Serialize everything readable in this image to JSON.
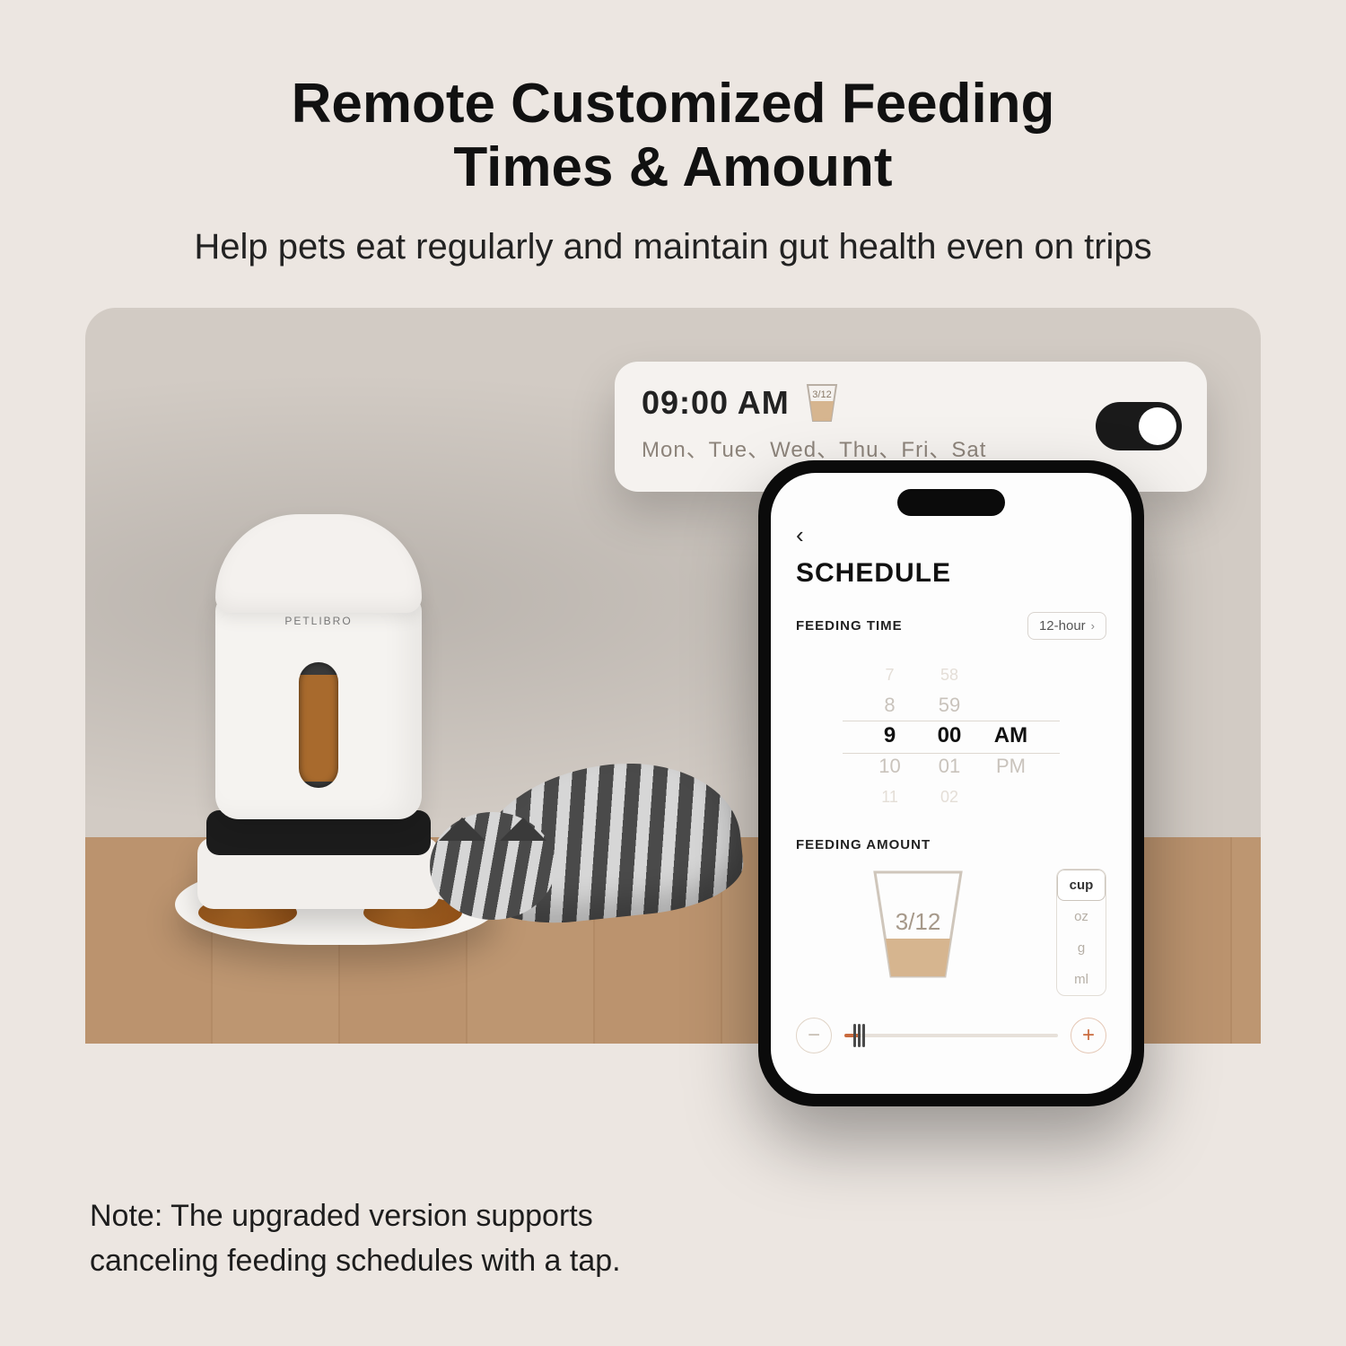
{
  "headline_l1": "Remote Customized Feeding",
  "headline_l2": "Times & Amount",
  "subhead": "Help pets eat regularly and maintain gut health even on trips",
  "feeder_brand": "PETLIBRO",
  "pill": {
    "time": "09:00 AM",
    "portion_label": "3/12",
    "days": "Mon、Tue、Wed、Thu、Fri、Sat",
    "toggle_on": true
  },
  "phone": {
    "back_glyph": "‹",
    "title": "SCHEDULE",
    "feeding_time_label": "FEEDING TIME",
    "time_format_chip": "12-hour",
    "picker": {
      "hours": [
        "7",
        "8",
        "9",
        "10",
        "11"
      ],
      "minutes": [
        "58",
        "59",
        "00",
        "01",
        "02"
      ],
      "ampm": [
        "AM",
        "PM"
      ],
      "selected_hour": "9",
      "selected_minute": "00",
      "selected_ampm": "AM"
    },
    "feeding_amount_label": "FEEDING AMOUNT",
    "cup_fraction": "3/12",
    "units": [
      "cup",
      "oz",
      "g",
      "ml"
    ],
    "selected_unit": "cup",
    "minus": "−",
    "plus": "+"
  },
  "note": "Note: The upgraded version supports canceling feeding schedules with a tap."
}
